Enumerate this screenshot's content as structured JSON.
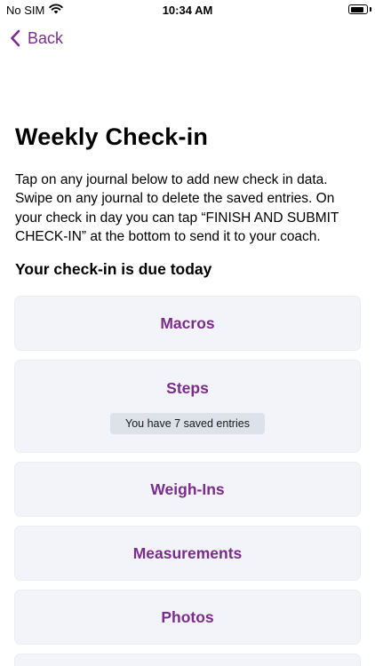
{
  "status_bar": {
    "carrier": "No SIM",
    "time": "10:34 AM",
    "battery_level": 0.9,
    "icons": [
      "wifi-icon",
      "battery-icon"
    ]
  },
  "nav": {
    "back_label": "Back",
    "back_icon": "chevron-left-icon"
  },
  "page": {
    "title": "Weekly Check-in",
    "intro": "Tap on any journal below to add new check in data. Swipe on any journal to delete the saved entries. On your check in day you can tap “FINISH AND SUBMIT CHECK-IN” at the bottom to send it to your coach.",
    "due_text": "Your check-in is due today"
  },
  "journals": [
    {
      "label": "Macros"
    },
    {
      "label": "Steps",
      "badge": "You have 7 saved entries"
    },
    {
      "label": "Weigh-Ins"
    },
    {
      "label": "Measurements"
    },
    {
      "label": "Photos"
    }
  ],
  "colors": {
    "accent": "#7b2c8c",
    "card_background": "#f3f4f9",
    "badge_background": "#dde1ea"
  }
}
